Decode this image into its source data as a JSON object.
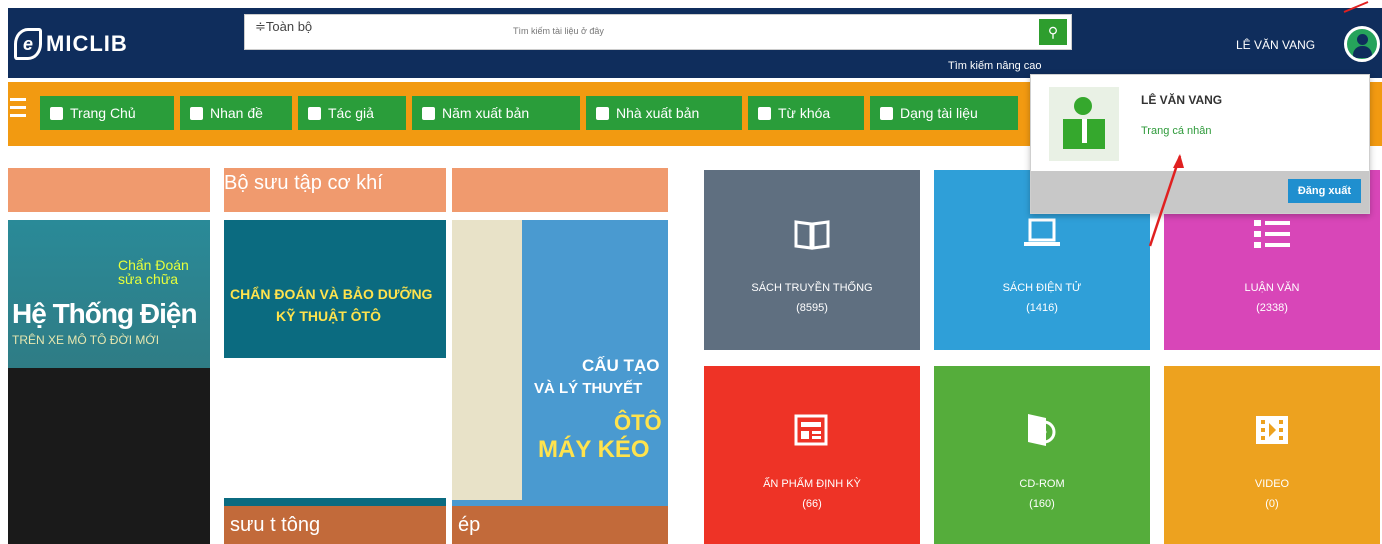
{
  "header": {
    "logo_mark": "e",
    "logo_text": "MICLIB",
    "search_scope": "≑Toàn bộ",
    "search_placeholder": "Tìm kiếm tài liệu ở đây",
    "search_icon": "search-icon",
    "advanced_search": "Tìm kiếm nâng cao",
    "username": "LÊ VĂN VANG",
    "brand_color": "#0f2d5c"
  },
  "nav": {
    "menu_icon": "hamburger-icon",
    "items": [
      {
        "label": "Trang Chủ",
        "icon": "home-icon"
      },
      {
        "label": "Nhan đề",
        "icon": "title-icon"
      },
      {
        "label": "Tác giả",
        "icon": "author-icon"
      },
      {
        "label": "Năm xuất bản",
        "icon": "calendar-icon"
      },
      {
        "label": "Nhà xuất bản",
        "icon": "bookmark-icon"
      },
      {
        "label": "Từ khóa",
        "icon": "tag-icon"
      },
      {
        "label": "Dạng tài liệu",
        "icon": "document-type-icon"
      }
    ],
    "bar_color": "#f29a11",
    "item_color": "#2a9d3a"
  },
  "covers": [
    {
      "overlay": "",
      "bottom": "",
      "line1": "Chẩn Đoán sửa chữa",
      "line2": "Hệ Thống Điện",
      "line3": "TRÊN XE MÔ TÔ ĐỜI MỚI"
    },
    {
      "overlay": "Bộ sưu tập cơ khí",
      "bottom": "sưu t   tông",
      "line1": "CHẨN ĐOÁN VÀ BẢO DƯỠNG",
      "line2": "KỸ THUẬT ÔTÔ"
    },
    {
      "overlay": "",
      "bottom": "ép",
      "line1": "CẤU TẠO",
      "line2": "VÀ LÝ THUYẾT",
      "line3": "ÔTÔ",
      "line4": "MÁY KÉO"
    }
  ],
  "tiles": [
    {
      "label": "SÁCH TRUYỀN THỐNG",
      "count": "(8595)",
      "icon": "book-open-icon",
      "color": "#5f6f80"
    },
    {
      "label": "SÁCH ĐIỆN TỬ",
      "count": "(1416)",
      "icon": "laptop-icon",
      "color": "#2f9fd8"
    },
    {
      "label": "LUẬN VĂN",
      "count": "(2338)",
      "icon": "list-icon",
      "color": "#d846b8"
    },
    {
      "label": "ẤN PHẨM ĐỊNH KỲ",
      "count": "(66)",
      "icon": "newspaper-icon",
      "color": "#ee3326"
    },
    {
      "label": "CD-ROM",
      "count": "(160)",
      "icon": "cd-icon",
      "color": "#55ad3b"
    },
    {
      "label": "VIDEO",
      "count": "(0)",
      "icon": "film-icon",
      "color": "#eda21f"
    }
  ],
  "dropdown": {
    "name": "LÊ VĂN VANG",
    "profile_link": "Trang cá nhân",
    "logout": "Đăng xuất"
  }
}
